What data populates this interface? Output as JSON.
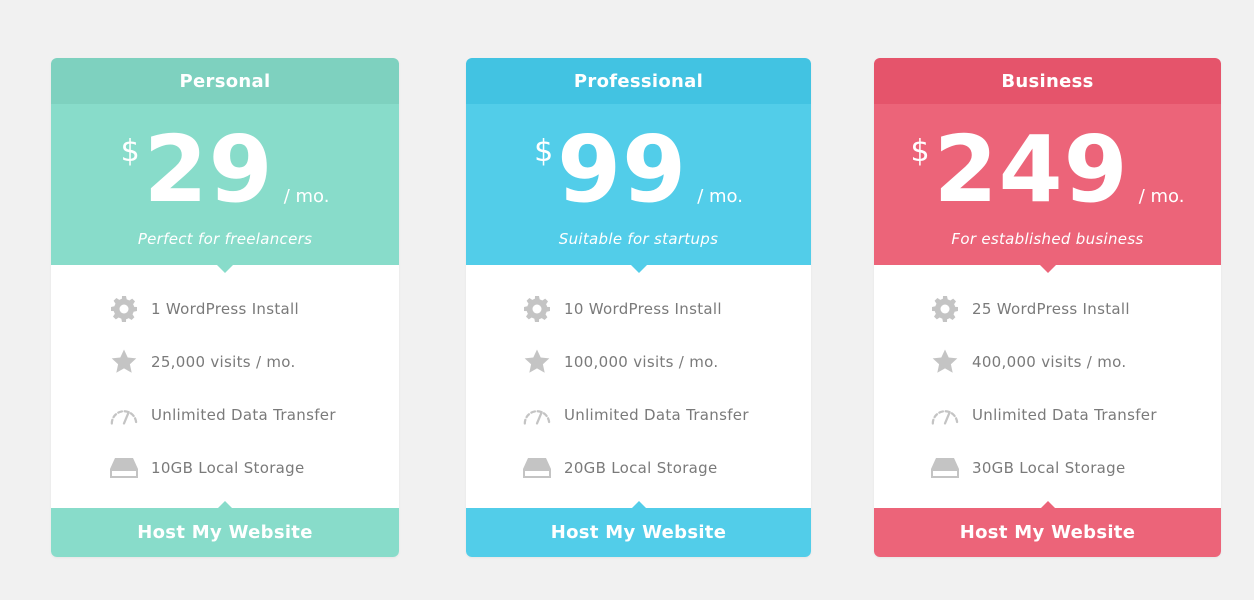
{
  "plans": [
    {
      "name": "Personal",
      "currency": "$",
      "price": "29",
      "period": "/ mo.",
      "tagline": "Perfect for freelancers",
      "features": [
        {
          "icon": "gear-icon",
          "text": "1 WordPress Install"
        },
        {
          "icon": "star-icon",
          "text": "25,000 visits / mo."
        },
        {
          "icon": "speedometer-icon",
          "text": "Unlimited Data Transfer"
        },
        {
          "icon": "storage-icon",
          "text": "10GB Local Storage"
        }
      ],
      "cta": "Host My Website"
    },
    {
      "name": "Professional",
      "currency": "$",
      "price": "99",
      "period": "/ mo.",
      "tagline": "Suitable for startups",
      "features": [
        {
          "icon": "gear-icon",
          "text": "10 WordPress Install"
        },
        {
          "icon": "star-icon",
          "text": "100,000 visits / mo."
        },
        {
          "icon": "speedometer-icon",
          "text": "Unlimited Data Transfer"
        },
        {
          "icon": "storage-icon",
          "text": "20GB Local Storage"
        }
      ],
      "cta": "Host My Website"
    },
    {
      "name": "Business",
      "currency": "$",
      "price": "249",
      "period": "/ mo.",
      "tagline": "For established business",
      "features": [
        {
          "icon": "gear-icon",
          "text": "25 WordPress Install"
        },
        {
          "icon": "star-icon",
          "text": "400,000 visits / mo."
        },
        {
          "icon": "speedometer-icon",
          "text": "Unlimited Data Transfer"
        },
        {
          "icon": "storage-icon",
          "text": "30GB Local Storage"
        }
      ],
      "cta": "Host My Website"
    }
  ],
  "colors": {
    "personal": "#88dcca",
    "professional": "#52cde9",
    "business": "#ec6479",
    "feature_text": "#7a7a7a",
    "feature_icon": "#c4c4c4",
    "background": "#f1f1f1"
  }
}
